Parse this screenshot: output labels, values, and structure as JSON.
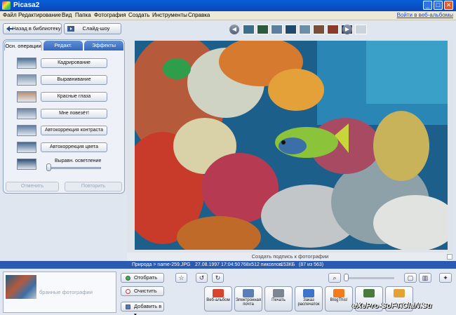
{
  "window": {
    "title": "Picasa2",
    "buttons": [
      "_",
      "□",
      "✕"
    ]
  },
  "menu": {
    "items": [
      "Файл",
      "Редактирование",
      "Вид",
      "Папка",
      "Фотография",
      "Создать",
      "Инструменты",
      "Справка"
    ],
    "web_link": "Войти в веб-альбомы"
  },
  "toolbar": {
    "back_label": "Назад в библиотеку",
    "slideshow_label": "Слайд-шоу"
  },
  "filmstrip": {
    "prev": "◀",
    "next": "▶",
    "thumbs": [
      "#3a6e8a",
      "#2b5a3c",
      "#5a7fa0",
      "#1e4a6e",
      "#6c8ea8",
      "#7a4f3a",
      "#8c3a2a",
      "#2c3e6a",
      "#c8d3dc"
    ]
  },
  "tabs": [
    "Осн. операции",
    "Редакт.",
    "Эффекты"
  ],
  "operations": [
    {
      "label": "Кадрирование",
      "thumb": "#4d6f93"
    },
    {
      "label": "Выравнивание",
      "thumb": "#7d93a8"
    },
    {
      "label": "Красные глаза",
      "thumb": "#b88d6c"
    },
    {
      "label": "Мне повезёт!",
      "thumb": "#6f86a0"
    },
    {
      "label": "Автокоррекция контраста",
      "thumb": "#5d7da3"
    },
    {
      "label": "Автокоррекция цвета",
      "thumb": "#43678e"
    },
    {
      "label": "",
      "thumb": "#2e4f73"
    }
  ],
  "fill_light": {
    "label": "Выравн. осветление",
    "value": 0.0
  },
  "undo_label": "Отменить",
  "redo_label": "Повторить",
  "caption_placeholder": "Создать подпись к фотографии",
  "info": {
    "path": "Природа > name-259.JPG",
    "date": "27.08.1997 17:04:50",
    "dims": "768x512 пикселов",
    "size": "153КБ",
    "count": "(87 из 563)"
  },
  "tray": {
    "label": "бранные фотографии",
    "hold_label": "Отобрать",
    "clear_label": "Очистить",
    "add_label": "Добавить в ▾"
  },
  "tools": [
    {
      "label": "Веб-альбом",
      "color": "#d9442e"
    },
    {
      "label": "Электронная почта",
      "color": "#5b7fb5"
    },
    {
      "label": "Печать",
      "color": "#7d8593"
    },
    {
      "label": "Заказ распечаток",
      "color": "#3e74c9"
    },
    {
      "label": "BlogThis!",
      "color": "#f27b1c"
    },
    {
      "label": "",
      "color": "#4a7b3a"
    },
    {
      "label": "",
      "color": "#e3a236"
    }
  ],
  "watermark": "eXePro-SoFT.ClaN.Su"
}
